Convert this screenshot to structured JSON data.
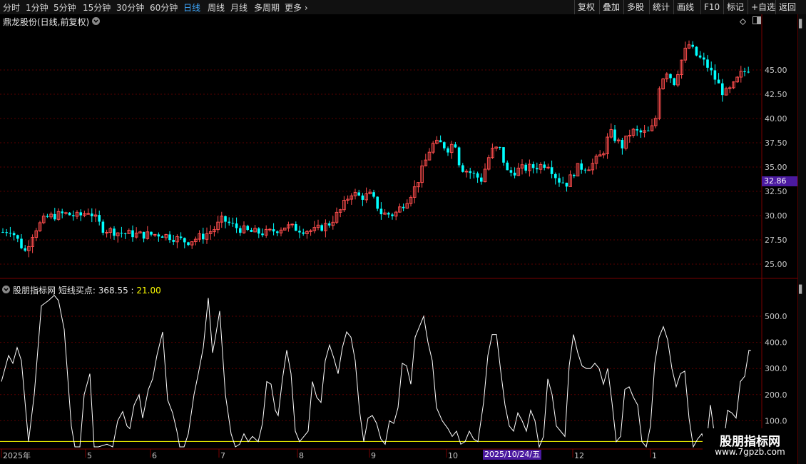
{
  "toolbar": {
    "periods": [
      "分时",
      "1分钟",
      "5分钟",
      "15分钟",
      "30分钟",
      "60分钟",
      "日线",
      "周线",
      "月线",
      "多周期"
    ],
    "active": "日线",
    "more": "更多",
    "right_buttons": [
      "复权",
      "叠加",
      "多股",
      "统计",
      "画线",
      "F10",
      "标记",
      "+自选",
      "返回"
    ]
  },
  "main_chart": {
    "title": "鼎龙股份(日线,前复权)",
    "y_ticks": [
      "45.00",
      "42.50",
      "40.00",
      "37.50",
      "35.00",
      "32.50",
      "30.00",
      "27.50",
      "25.00"
    ],
    "current_price": "32.86"
  },
  "indicator": {
    "name": "股朋指标网",
    "label": "短线买点:",
    "value1": "368.55",
    "value2": "21.00",
    "y_ticks": [
      "500.0",
      "400.0",
      "300.0",
      "200.0",
      "100.0"
    ]
  },
  "x_axis": {
    "labels": [
      "2025年",
      "5",
      "6",
      "7",
      "8",
      "9",
      "10",
      "12",
      "1"
    ],
    "highlight_date": "2025/10/24/五"
  },
  "watermark": {
    "line1": "股朋指标网",
    "line2": "www.7gpzb.com"
  },
  "colors": {
    "up": "#ff4d4d",
    "down": "#00ffff",
    "line": "#ffffff",
    "threshold": "#ffff00",
    "grid": "#5a0000"
  }
}
